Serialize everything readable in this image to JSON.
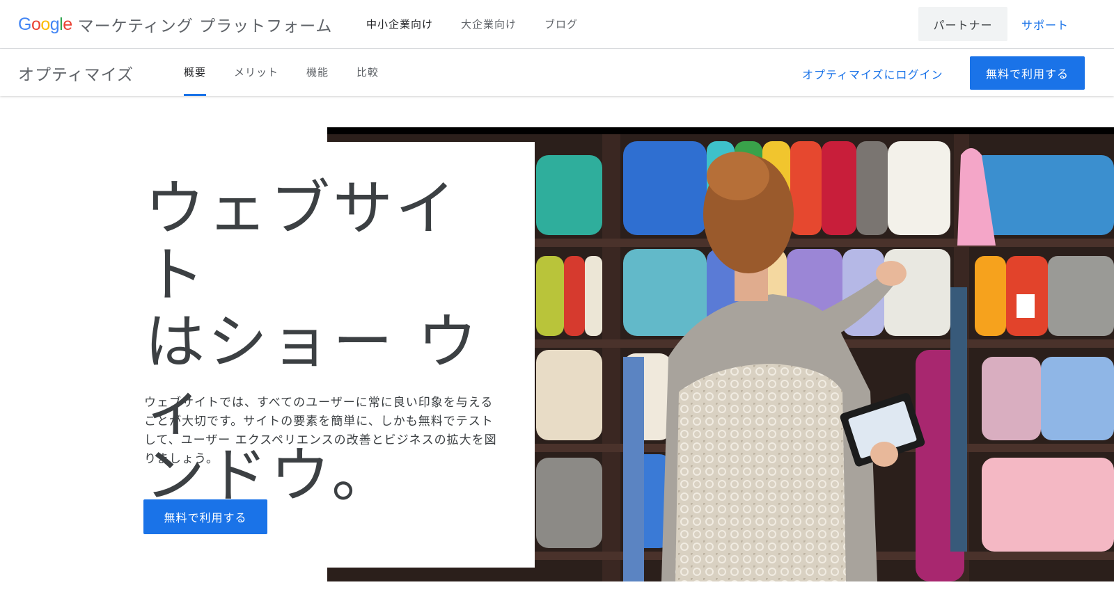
{
  "header": {
    "logo_letters": [
      {
        "char": "G",
        "color": "#4285F4"
      },
      {
        "char": "o",
        "color": "#EA4335"
      },
      {
        "char": "o",
        "color": "#FBBC05"
      },
      {
        "char": "g",
        "color": "#4285F4"
      },
      {
        "char": "l",
        "color": "#34A853"
      },
      {
        "char": "e",
        "color": "#EA4335"
      }
    ],
    "brand_suffix": "マーケティング プラットフォーム",
    "nav": [
      {
        "label": "中小企業向け",
        "active": true
      },
      {
        "label": "大企業向け",
        "active": false
      },
      {
        "label": "ブログ",
        "active": false
      }
    ],
    "partner_label": "パートナー",
    "support_label": "サポート"
  },
  "subheader": {
    "product_name": "オプティマイズ",
    "tabs": [
      {
        "label": "概要",
        "active": true
      },
      {
        "label": "メリット",
        "active": false
      },
      {
        "label": "機能",
        "active": false
      },
      {
        "label": "比較",
        "active": false
      }
    ],
    "login_label": "オプティマイズにログイン",
    "cta_label": "無料で利用する"
  },
  "hero": {
    "headline_lines": [
      "ウェブサイト",
      "はショー ウィ",
      "ンドウ。"
    ],
    "body": "ウェブサイトでは、すべてのユーザーに常に良い印象を与えることが大切です。サイトの要素を簡単に、しかも無料でテストして、ユーザー エクスペリエンスの改善とビジネスの拡大を図りましょう。",
    "cta_label": "無料で利用する",
    "image_subject": "yarn-shop-photo"
  },
  "colors": {
    "accent": "#1a73e8",
    "text_primary": "#202124",
    "text_secondary": "#5f6368",
    "divider": "#dadce0",
    "partner_bg": "#f1f3f4"
  }
}
